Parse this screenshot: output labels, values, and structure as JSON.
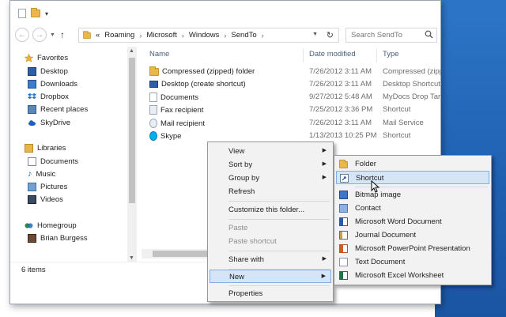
{
  "colors": {
    "accent": "#2d76c7",
    "highlight": "#d5e5f6",
    "folder": "#e8b84a"
  },
  "qat": {
    "dropdown": "▾"
  },
  "address": {
    "overflow": "«",
    "crumbs": [
      "Roaming",
      "Microsoft",
      "Windows",
      "SendTo"
    ],
    "separator": "›",
    "search_placeholder": "Search SendTo"
  },
  "sidebar": {
    "favorites": {
      "label": "Favorites",
      "items": [
        "Desktop",
        "Downloads",
        "Dropbox",
        "Recent places",
        "SkyDrive"
      ]
    },
    "libraries": {
      "label": "Libraries",
      "items": [
        "Documents",
        "Music",
        "Pictures",
        "Videos"
      ]
    },
    "homegroup": {
      "label": "Homegroup",
      "items": [
        "Brian Burgess"
      ]
    }
  },
  "columns": {
    "name": "Name",
    "date": "Date modified",
    "type": "Type"
  },
  "files": [
    {
      "name": "Compressed (zipped) folder",
      "date": "7/26/2012 3:11 AM",
      "type": "Compressed (zipp...",
      "icon": "zip-folder-icon"
    },
    {
      "name": "Desktop (create shortcut)",
      "date": "7/26/2012 3:11 AM",
      "type": "Desktop Shortcut",
      "icon": "desktop-icon"
    },
    {
      "name": "Documents",
      "date": "9/27/2012 5:48 AM",
      "type": "MyDocs Drop Tar...",
      "icon": "documents-icon"
    },
    {
      "name": "Fax recipient",
      "date": "7/25/2012 3:36 PM",
      "type": "Shortcut",
      "icon": "fax-icon"
    },
    {
      "name": "Mail recipient",
      "date": "7/26/2012 3:11 AM",
      "type": "Mail Service",
      "icon": "mail-icon"
    },
    {
      "name": "Skype",
      "date": "1/13/2013 10:25 PM",
      "type": "Shortcut",
      "icon": "skype-icon"
    }
  ],
  "status": {
    "items": "6 items"
  },
  "context_menu": {
    "view": "View",
    "sort_by": "Sort by",
    "group_by": "Group by",
    "refresh": "Refresh",
    "customize": "Customize this folder...",
    "paste": "Paste",
    "paste_shortcut": "Paste shortcut",
    "share_with": "Share with",
    "new": "New",
    "properties": "Properties"
  },
  "new_submenu": {
    "folder": "Folder",
    "shortcut": "Shortcut",
    "bitmap": "Bitmap image",
    "contact": "Contact",
    "word": "Microsoft Word Document",
    "journal": "Journal Document",
    "powerpoint": "Microsoft PowerPoint Presentation",
    "text": "Text Document",
    "excel": "Microsoft Excel Worksheet"
  }
}
